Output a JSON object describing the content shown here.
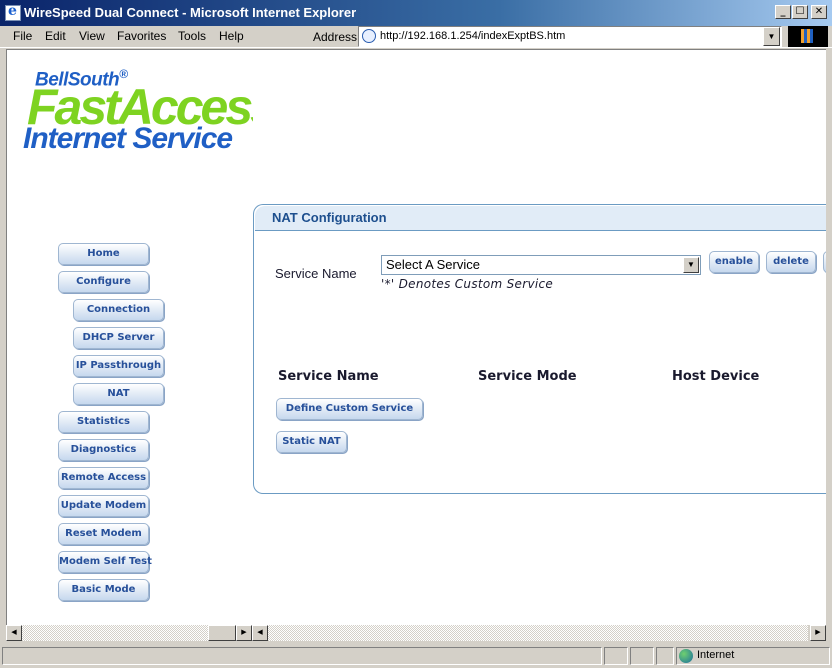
{
  "window": {
    "title": "WireSpeed Dual Connect - Microsoft Internet Explorer",
    "min_glyph": "_",
    "max_glyph": "☐",
    "close_glyph": "✕"
  },
  "menu": {
    "items": [
      "File",
      "Edit",
      "View",
      "Favorites",
      "Tools",
      "Help"
    ],
    "address_label": "Address",
    "url": "http://192.168.1.254/indexExptBS.htm"
  },
  "logo": {
    "bellsouth": "BellSouth",
    "registered": "®",
    "fastaccess": "FastAccess",
    "internet_service": "Internet Service"
  },
  "nav": {
    "items": [
      {
        "label": "Home"
      },
      {
        "label": "Configure"
      },
      {
        "label": "Connection"
      },
      {
        "label": "DHCP Server"
      },
      {
        "label": "IP Passthrough"
      },
      {
        "label": "NAT"
      },
      {
        "label": "Statistics"
      },
      {
        "label": "Diagnostics"
      },
      {
        "label": "Remote Access"
      },
      {
        "label": "Update Modem"
      },
      {
        "label": "Reset Modem"
      },
      {
        "label": "Modem Self Test"
      },
      {
        "label": "Basic Mode"
      }
    ]
  },
  "nat": {
    "title": "NAT Configuration",
    "service_label": "Service Name",
    "select_value": "Select A Service",
    "note": "'*' Denotes Custom Service",
    "enable_label": "enable",
    "delete_label": "delete",
    "col_service_name": "Service Name",
    "col_service_mode": "Service Mode",
    "col_host_device": "Host Device",
    "define_custom_label": "Define Custom Service",
    "static_nat_label": "Static NAT"
  },
  "status": {
    "zone": "Internet"
  }
}
